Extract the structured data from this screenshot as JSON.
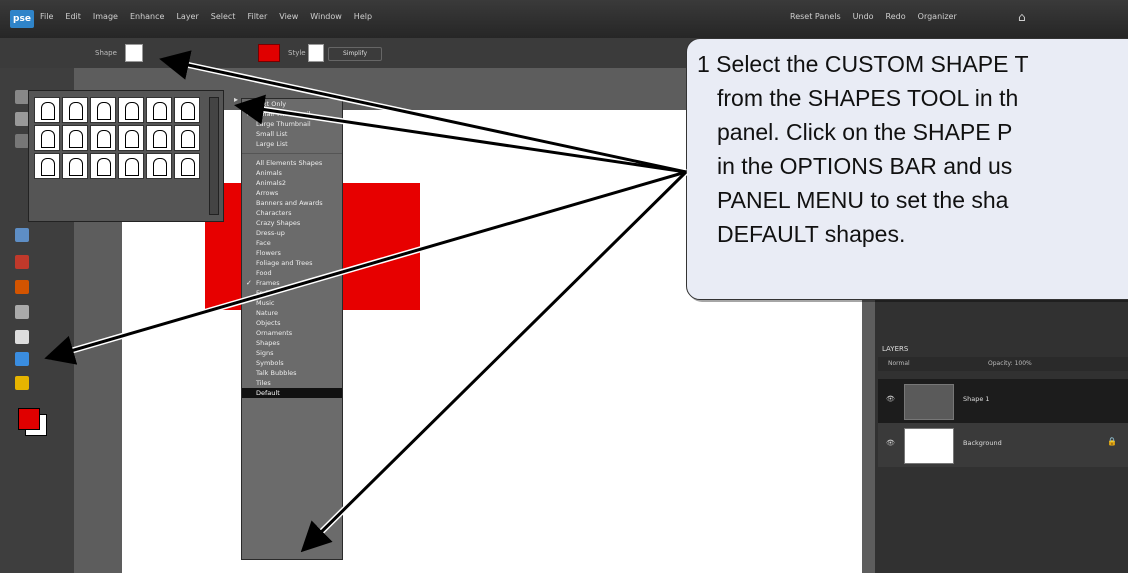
{
  "app": {
    "logo": "pse",
    "menus": [
      "File",
      "Edit",
      "Image",
      "Enhance",
      "Layer",
      "Select",
      "Filter",
      "View",
      "Window",
      "Help"
    ],
    "right_buttons": [
      "Reset Panels",
      "Undo",
      "Redo",
      "Organizer"
    ]
  },
  "options_bar": {
    "shape_label": "Shape",
    "style_label": "Style",
    "simplify_label": "Simplify"
  },
  "panel_menu": {
    "items": [
      {
        "label": "Text Only",
        "check": false
      },
      {
        "label": "Small Thumbnail",
        "check": true
      },
      {
        "label": "Large Thumbnail",
        "check": false
      },
      {
        "label": "Small List",
        "check": false
      },
      {
        "label": "Large List",
        "check": false
      },
      {
        "sep": true
      },
      {
        "label": "All Elements Shapes",
        "check": false
      },
      {
        "label": "Animals",
        "check": false
      },
      {
        "label": "Animals2",
        "check": false
      },
      {
        "label": "Arrows",
        "check": false
      },
      {
        "label": "Banners and Awards",
        "check": false
      },
      {
        "label": "Characters",
        "check": false
      },
      {
        "label": "Crazy Shapes",
        "check": false
      },
      {
        "label": "Dress-up",
        "check": false
      },
      {
        "label": "Face",
        "check": false
      },
      {
        "label": "Flowers",
        "check": false
      },
      {
        "label": "Foliage and Trees",
        "check": false
      },
      {
        "label": "Food",
        "check": false
      },
      {
        "label": "Frames",
        "check": true
      },
      {
        "label": "Fruit",
        "check": false
      },
      {
        "label": "Music",
        "check": false
      },
      {
        "label": "Nature",
        "check": false
      },
      {
        "label": "Objects",
        "check": false
      },
      {
        "label": "Ornaments",
        "check": false
      },
      {
        "label": "Shapes",
        "check": false
      },
      {
        "label": "Signs",
        "check": false
      },
      {
        "label": "Symbols",
        "check": false
      },
      {
        "label": "Talk Bubbles",
        "check": false
      },
      {
        "label": "Tiles",
        "check": false
      },
      {
        "label": "Default",
        "check": false,
        "selected": true
      }
    ]
  },
  "layers": {
    "title": "LAYERS",
    "blend_mode": "Normal",
    "opacity": "Opacity: 100%",
    "items": [
      {
        "name": "Shape 1",
        "thumb_color": "#5a5a5a"
      },
      {
        "name": "Background",
        "thumb_color": "#ffffff"
      }
    ]
  },
  "callout": {
    "line1": "1  Select the CUSTOM SHAPE T",
    "line2": "from the SHAPES TOOL in th",
    "line3": "panel.  Click on the SHAPE P",
    "line4": "in the OPTIONS BAR and us",
    "line5": "PANEL MENU to set the sha",
    "line6": "DEFAULT shapes."
  },
  "colors": {
    "accent_red": "#e70000",
    "callout_bg": "#e9ecf5"
  }
}
